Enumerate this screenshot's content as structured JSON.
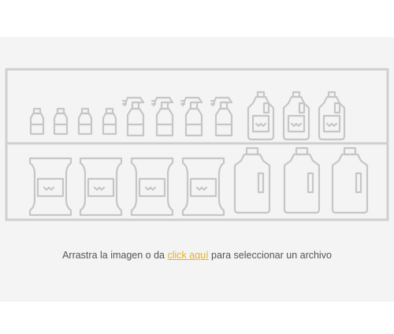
{
  "upload": {
    "text_before": "Arrastra la imagen o da ",
    "link_label": "click aquí",
    "text_after": " para seleccionar un archivo"
  },
  "illustration": {
    "name": "store-shelf-products",
    "top_row": [
      "small-bottle-icon",
      "small-bottle-icon",
      "small-bottle-icon",
      "small-bottle-icon",
      "spray-bottle-icon",
      "spray-bottle-icon",
      "spray-bottle-icon",
      "spray-bottle-icon",
      "jug-icon",
      "jug-icon",
      "jug-icon"
    ],
    "bottom_row": [
      "bag-icon",
      "bag-icon",
      "bag-icon",
      "bag-icon",
      "detergent-bottle-icon",
      "detergent-bottle-icon",
      "detergent-bottle-icon"
    ]
  },
  "colors": {
    "background": "#f4f4f4",
    "outline": "#c6c6c6",
    "link": "#e8b21c",
    "text": "#555555"
  }
}
